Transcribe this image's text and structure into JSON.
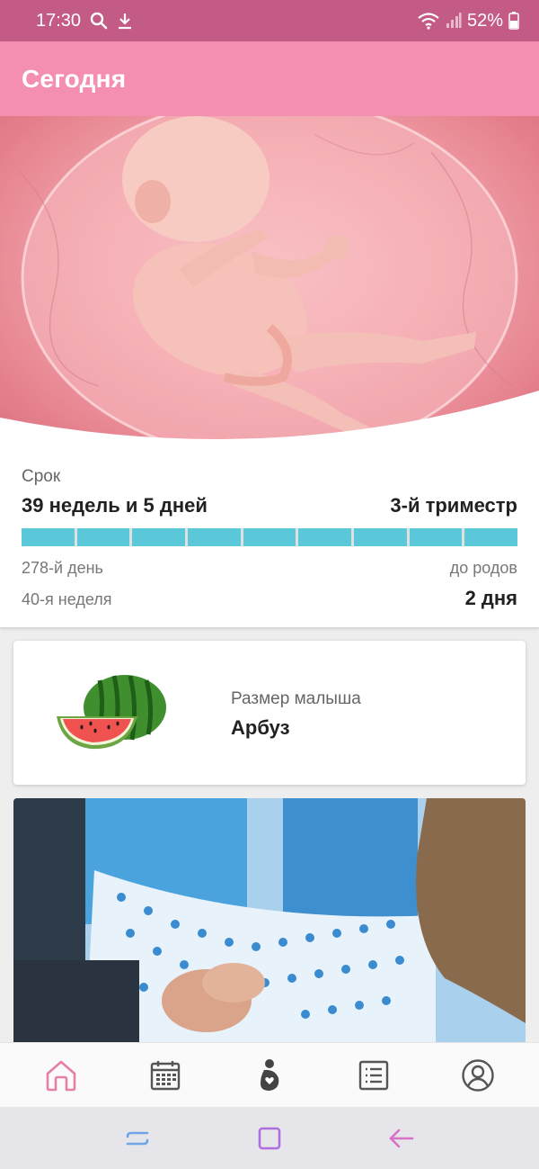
{
  "status_bar": {
    "time": "17:30",
    "battery": "52%",
    "icons": [
      "search-icon",
      "download-icon",
      "wifi-icon",
      "signal-icon",
      "battery-icon"
    ]
  },
  "app_bar": {
    "title": "Сегодня"
  },
  "term": {
    "label": "Срок",
    "weeks_text": "39 недель и 5 дней",
    "trimester_text": "3-й триместр",
    "progress_segments": 9,
    "day_text": "278-й день",
    "week_text": "40-я неделя",
    "until_label": "до родов",
    "until_value": "2 дня"
  },
  "baby_size": {
    "label": "Размер малыша",
    "value": "Арбуз",
    "icon": "watermelon-icon"
  },
  "bottom_nav": {
    "items": [
      {
        "name": "home",
        "icon": "home-icon",
        "active": true
      },
      {
        "name": "calendar",
        "icon": "calendar-icon",
        "active": false
      },
      {
        "name": "pregnancy",
        "icon": "pregnancy-icon",
        "active": false
      },
      {
        "name": "list",
        "icon": "list-icon",
        "active": false
      },
      {
        "name": "profile",
        "icon": "profile-icon",
        "active": false
      }
    ]
  },
  "system_nav": {
    "icons": [
      "recent-apps-icon",
      "home-square-icon",
      "back-arrow-icon"
    ]
  },
  "colors": {
    "status_bar": "#c45a86",
    "app_bar": "#f48fb1",
    "progress": "#5ac8d8",
    "active_nav": "#e57fa8",
    "inactive_nav": "#555555"
  }
}
